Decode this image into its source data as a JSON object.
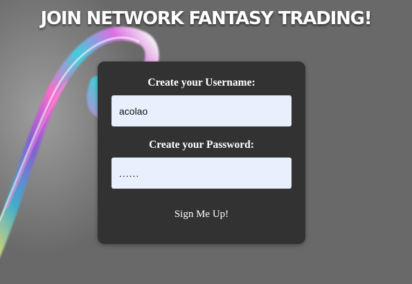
{
  "page": {
    "title": "JOIN NETWORK FANTASY TRADING!"
  },
  "form": {
    "username_label": "Create your Username:",
    "username_value": "acolao",
    "password_label": "Create your Password:",
    "password_value": "......",
    "submit_label": "Sign Me Up!"
  },
  "colors": {
    "page_background": "#696969",
    "panel_background": "#323232",
    "input_background": "#e8f0fe",
    "text": "#ffffff"
  }
}
